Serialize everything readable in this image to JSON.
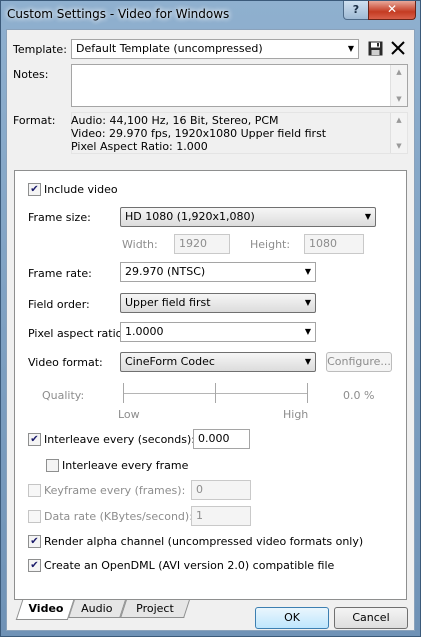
{
  "window": {
    "title": "Custom Settings - Video for Windows",
    "help_glyph": "?",
    "close_glyph": "✕"
  },
  "template": {
    "label": "Template:",
    "value": "Default Template (uncompressed)"
  },
  "notes": {
    "label": "Notes:",
    "value": ""
  },
  "format": {
    "label": "Format:",
    "lines": [
      "Audio: 44,100 Hz, 16 Bit, Stereo, PCM",
      "Video: 29.970 fps, 1920x1080 Upper field first",
      "Pixel Aspect Ratio: 1.000"
    ]
  },
  "video": {
    "include_video": {
      "label": "Include video",
      "checked": true
    },
    "frame_size": {
      "label": "Frame size:",
      "value": "HD 1080 (1,920x1,080)"
    },
    "width": {
      "label": "Width:",
      "value": "1920"
    },
    "height": {
      "label": "Height:",
      "value": "1080"
    },
    "frame_rate": {
      "label": "Frame rate:",
      "value": "29.970 (NTSC)"
    },
    "field_order": {
      "label": "Field order:",
      "value": "Upper field first"
    },
    "pixel_aspect": {
      "label": "Pixel aspect ratio:",
      "value": "1.0000"
    },
    "video_format": {
      "label": "Video format:",
      "value": "CineForm Codec",
      "configure_label": "Configure..."
    },
    "quality": {
      "label": "Quality:",
      "low_label": "Low",
      "high_label": "High",
      "value_text": "0.0 %",
      "level": 0.0
    },
    "interleave_seconds": {
      "label": "Interleave every (seconds):",
      "checked": true,
      "value": "0.000"
    },
    "interleave_frame": {
      "label": "Interleave every frame",
      "checked": false
    },
    "keyframe": {
      "label": "Keyframe every (frames):",
      "checked": false,
      "value": "0"
    },
    "data_rate": {
      "label": "Data rate (KBytes/second):",
      "checked": false,
      "value": "1"
    },
    "render_alpha": {
      "label": "Render alpha channel (uncompressed video formats only)",
      "checked": true
    },
    "opendml": {
      "label": "Create an OpenDML (AVI version 2.0) compatible file",
      "checked": true
    }
  },
  "tabs": [
    {
      "label": "Video",
      "active": true
    },
    {
      "label": "Audio",
      "active": false
    },
    {
      "label": "Project",
      "active": false
    }
  ],
  "buttons": {
    "ok": "OK",
    "cancel": "Cancel"
  },
  "icons": {
    "save": "save-icon",
    "delete": "delete-icon"
  }
}
